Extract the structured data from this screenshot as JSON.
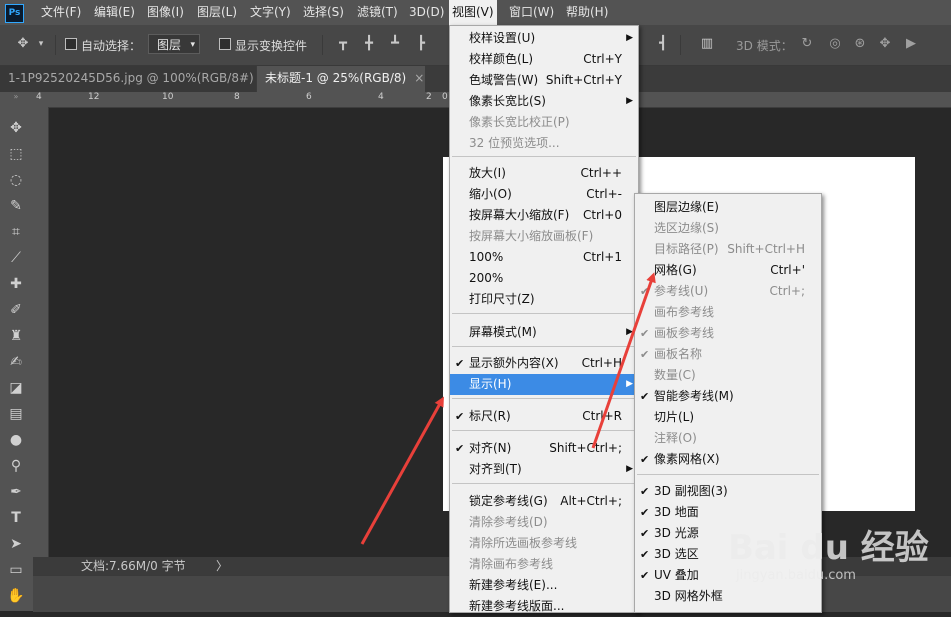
{
  "app_logo": "Ps",
  "menubar": [
    "文件(F)",
    "编辑(E)",
    "图像(I)",
    "图层(L)",
    "文字(Y)",
    "选择(S)",
    "滤镜(T)",
    "3D(D)",
    "视图(V)",
    "窗口(W)",
    "帮助(H)"
  ],
  "options": {
    "auto_select": "自动选择：",
    "layer_select": "图层",
    "show_transform": "显示变换控件",
    "mode_3d": "3D 模式："
  },
  "tabs": [
    {
      "label": "1-1P92520245D56.jpg @ 100%(RGB/8#)",
      "close": "×"
    },
    {
      "label": "未标题-1 @ 25%(RGB/8)",
      "close": "×"
    }
  ],
  "ruler_ticks": [
    "4",
    "12",
    "10",
    "8",
    "6",
    "4",
    "2",
    "0"
  ],
  "view_menu": [
    {
      "label": "校样设置(U)",
      "shortcut": "",
      "arrow": true,
      "disabled": false
    },
    {
      "label": "校样颜色(L)",
      "shortcut": "Ctrl+Y",
      "disabled": false
    },
    {
      "label": "色域警告(W)",
      "shortcut": "Shift+Ctrl+Y",
      "disabled": false
    },
    {
      "label": "像素长宽比(S)",
      "shortcut": "",
      "arrow": true,
      "disabled": false
    },
    {
      "label": "像素长宽比校正(P)",
      "shortcut": "",
      "disabled": true
    },
    {
      "label": "32 位预览选项...",
      "shortcut": "",
      "disabled": true
    },
    {
      "label": "放大(I)",
      "shortcut": "Ctrl++",
      "disabled": false
    },
    {
      "label": "缩小(O)",
      "shortcut": "Ctrl+-",
      "disabled": false
    },
    {
      "label": "按屏幕大小缩放(F)",
      "shortcut": "Ctrl+0",
      "disabled": false
    },
    {
      "label": "按屏幕大小缩放画板(F)",
      "shortcut": "",
      "disabled": true
    },
    {
      "label": "100%",
      "shortcut": "Ctrl+1",
      "disabled": false
    },
    {
      "label": "200%",
      "shortcut": "",
      "disabled": false
    },
    {
      "label": "打印尺寸(Z)",
      "shortcut": "",
      "disabled": false
    },
    {
      "label": "屏幕模式(M)",
      "shortcut": "",
      "arrow": true,
      "disabled": false
    },
    {
      "label": "显示额外内容(X)",
      "shortcut": "Ctrl+H",
      "checked": true,
      "disabled": false
    },
    {
      "label": "显示(H)",
      "shortcut": "",
      "arrow": true,
      "highlight": true,
      "disabled": false
    },
    {
      "label": "标尺(R)",
      "shortcut": "Ctrl+R",
      "checked": true,
      "disabled": false
    },
    {
      "label": "对齐(N)",
      "shortcut": "Shift+Ctrl+;",
      "checked": true,
      "disabled": false
    },
    {
      "label": "对齐到(T)",
      "shortcut": "",
      "arrow": true,
      "disabled": false
    },
    {
      "label": "锁定参考线(G)",
      "shortcut": "Alt+Ctrl+;",
      "disabled": false
    },
    {
      "label": "清除参考线(D)",
      "shortcut": "",
      "disabled": true
    },
    {
      "label": "清除所选画板参考线",
      "shortcut": "",
      "disabled": true
    },
    {
      "label": "清除画布参考线",
      "shortcut": "",
      "disabled": true
    },
    {
      "label": "新建参考线(E)...",
      "shortcut": "",
      "disabled": false
    },
    {
      "label": "新建参考线版面...",
      "shortcut": "",
      "disabled": false
    }
  ],
  "show_submenu": [
    {
      "label": "图层边缘(E)",
      "shortcut": "",
      "disabled": false
    },
    {
      "label": "选区边缘(S)",
      "shortcut": "",
      "disabled": true
    },
    {
      "label": "目标路径(P)",
      "shortcut": "Shift+Ctrl+H",
      "disabled": true
    },
    {
      "label": "网格(G)",
      "shortcut": "Ctrl+'",
      "disabled": false
    },
    {
      "label": "参考线(U)",
      "shortcut": "Ctrl+;",
      "checked": true,
      "disabled": true
    },
    {
      "label": "画布参考线",
      "shortcut": "",
      "disabled": true
    },
    {
      "label": "画板参考线",
      "shortcut": "",
      "checked": true,
      "disabled": true
    },
    {
      "label": "画板名称",
      "shortcut": "",
      "checked": true,
      "disabled": true
    },
    {
      "label": "数量(C)",
      "shortcut": "",
      "disabled": true
    },
    {
      "label": "智能参考线(M)",
      "shortcut": "",
      "checked": true,
      "disabled": false
    },
    {
      "label": "切片(L)",
      "shortcut": "",
      "disabled": false
    },
    {
      "label": "注释(O)",
      "shortcut": "",
      "disabled": true
    },
    {
      "label": "像素网格(X)",
      "shortcut": "",
      "checked": true,
      "disabled": false
    },
    {
      "label": "3D 副视图(3)",
      "shortcut": "",
      "checked": true,
      "disabled": false
    },
    {
      "label": "3D 地面",
      "shortcut": "",
      "checked": true,
      "disabled": false
    },
    {
      "label": "3D 光源",
      "shortcut": "",
      "checked": true,
      "disabled": false
    },
    {
      "label": "3D 选区",
      "shortcut": "",
      "checked": true,
      "disabled": false
    },
    {
      "label": "UV 叠加",
      "shortcut": "",
      "checked": true,
      "disabled": false
    },
    {
      "label": "3D 网格外框",
      "shortcut": "",
      "disabled": false
    }
  ],
  "status": {
    "doc_info": "文档:7.66M/0 字节",
    "arrow": "〉"
  },
  "watermark": {
    "text": "Bai du 经验",
    "sub": "jingyan.baidu.com"
  },
  "accent_color": "#3c8be5",
  "arrow_color": "#e8403a"
}
